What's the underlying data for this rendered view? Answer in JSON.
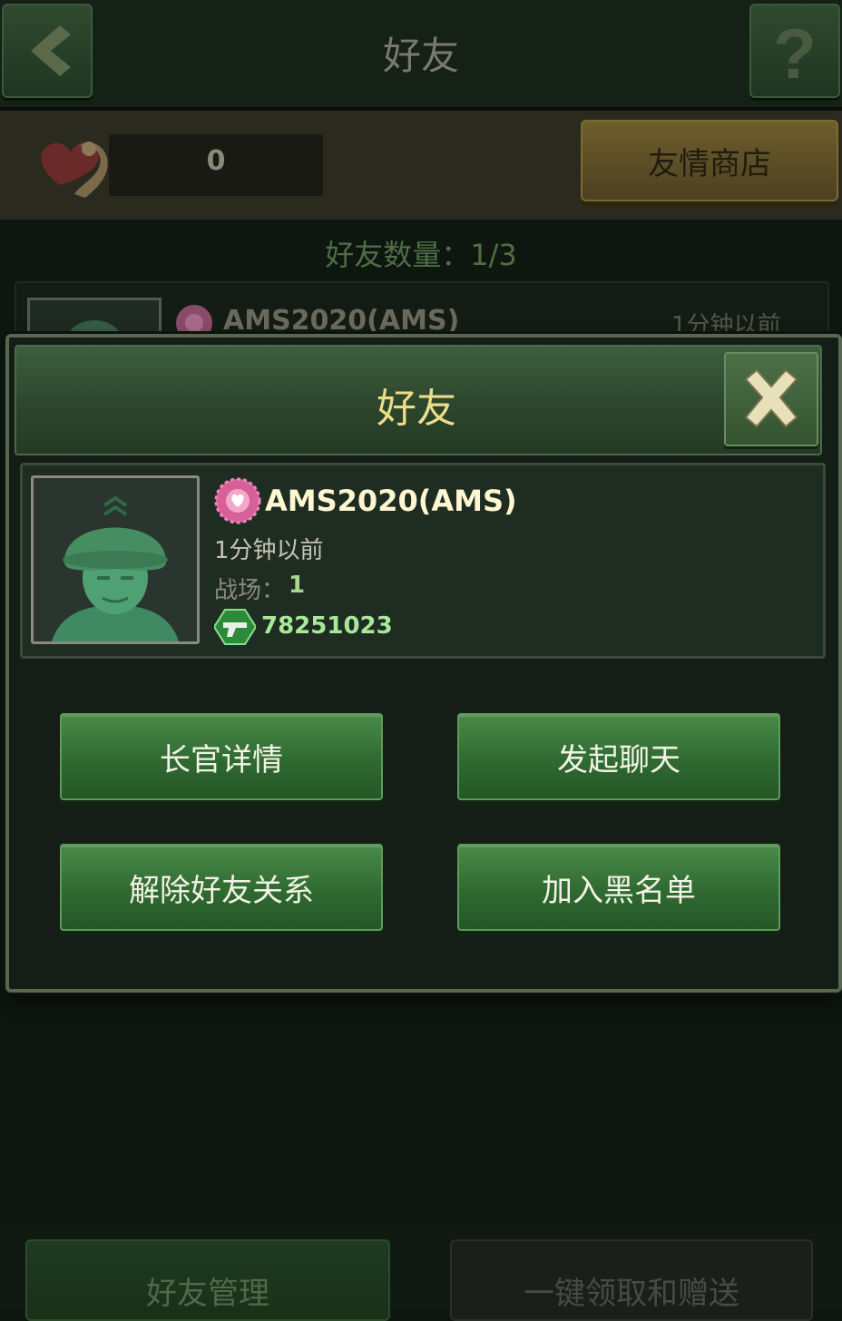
{
  "header": {
    "title": "好友",
    "back_icon": "back-arrow-icon",
    "help_icon": "question-icon"
  },
  "balance": {
    "value": "0",
    "icon": "friendship-heart-icon"
  },
  "shop_button": {
    "label": "友情商店"
  },
  "friend_count": {
    "label": "好友数量：1/3"
  },
  "list": [
    {
      "name": "AMS2020(AMS)",
      "time": "1分钟以前"
    }
  ],
  "modal": {
    "title": "好友",
    "close_icon": "close-x-icon",
    "player": {
      "name": "AMS2020(AMS)",
      "last_seen": "1分钟以前",
      "battlefield_label": "战场：",
      "battlefield_value": "1",
      "id": "78251023"
    },
    "buttons": {
      "details": "长官详情",
      "chat": "发起聊天",
      "unfriend": "解除好友关系",
      "blacklist": "加入黑名单"
    }
  },
  "bottom": {
    "manage": "好友管理",
    "collect_send": "一键领取和赠送"
  },
  "colors": {
    "accent_yellow": "#eedd88",
    "button_green": "#2f6a30",
    "id_green": "#a8e898"
  }
}
